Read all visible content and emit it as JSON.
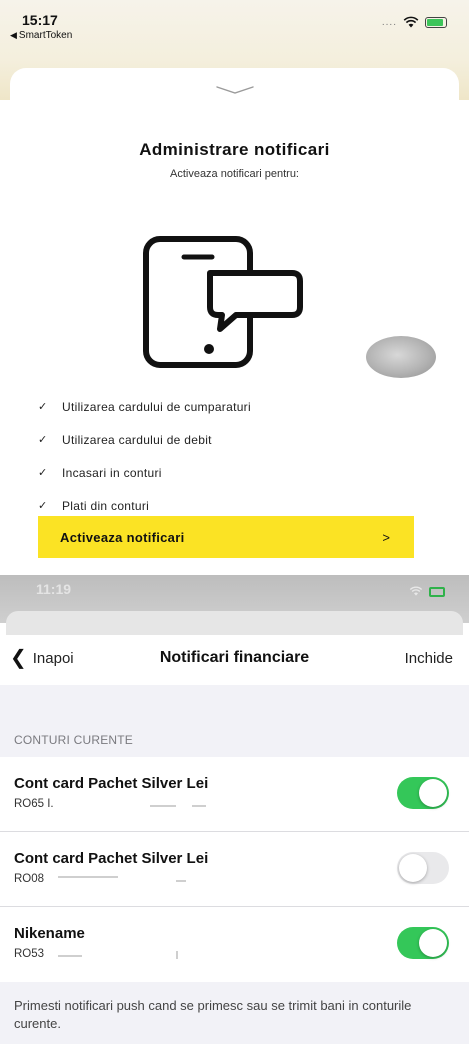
{
  "top_screen": {
    "status_bar": {
      "time": "15:17",
      "back_app": "SmartToken",
      "signal": "....",
      "icons": [
        "wifi-icon",
        "battery-charging-icon"
      ]
    },
    "title": "Administrare notificari",
    "subtitle": "Activeaza notificari pentru:",
    "illustration": "phone-with-chat-bubble-icon",
    "check_items": [
      {
        "icon": "check-icon",
        "label": "Utilizarea cardului de cumparaturi"
      },
      {
        "icon": "check-icon",
        "label": "Utilizarea cardului de debit"
      },
      {
        "icon": "check-icon",
        "label": "Incasari in conturi"
      },
      {
        "icon": "check-icon",
        "label": "Plati din conturi"
      }
    ],
    "cta": {
      "label": "Activeaza notificari",
      "chevron": ">"
    },
    "colors": {
      "accent_yellow": "#fbe324"
    }
  },
  "bottom_screen": {
    "status_bar": {
      "time": "11:19"
    },
    "nav": {
      "back_icon": "❮",
      "back_label": "Inapoi",
      "title": "Notificari financiare",
      "close_label": "Inchide"
    },
    "section_header": "CONTURI CURENTE",
    "accounts": [
      {
        "name": "Cont card Pachet Silver Lei",
        "iban": "RO65 I.",
        "enabled": true
      },
      {
        "name": "Cont card Pachet Silver Lei",
        "iban": "RO08",
        "enabled": false
      },
      {
        "name": "Nikename",
        "iban": "RO53",
        "enabled": true
      }
    ],
    "footer_note": "Primesti notificari push cand se primesc sau se trimit bani in conturile curente.",
    "colors": {
      "toggle_on": "#34c759",
      "toggle_off": "#e9e9eb",
      "group_background": "#f2f2f7"
    }
  }
}
